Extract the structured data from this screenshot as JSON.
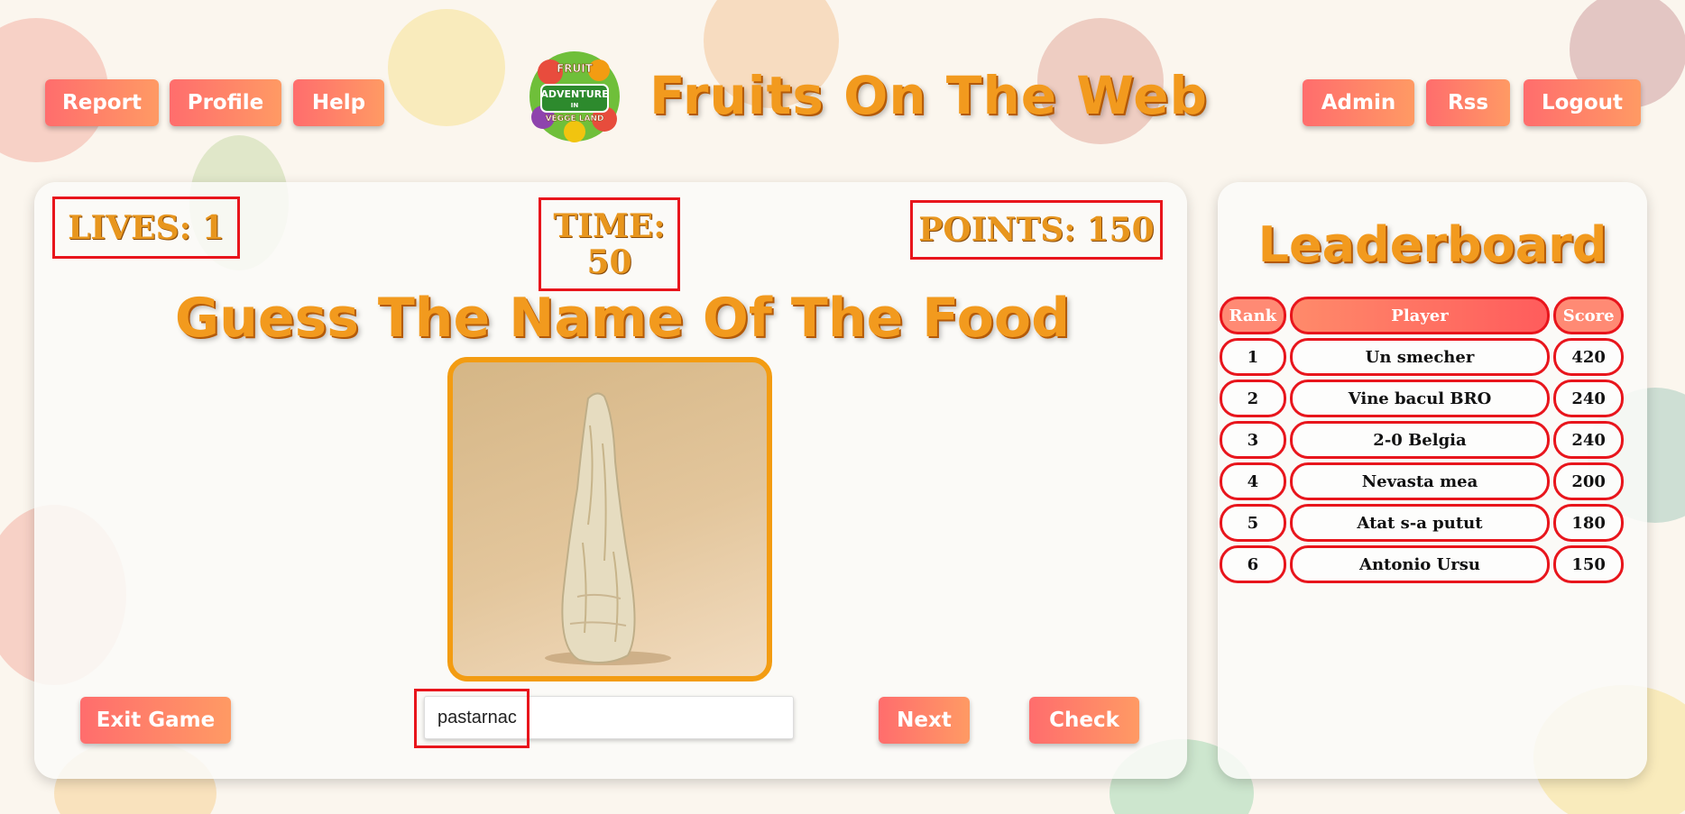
{
  "nav_left": [
    {
      "label": "Report"
    },
    {
      "label": "Profile"
    },
    {
      "label": "Help"
    }
  ],
  "nav_right": [
    {
      "label": "Admin"
    },
    {
      "label": "Rss"
    },
    {
      "label": "Logout"
    }
  ],
  "header": {
    "title": "Fruits On The Web",
    "logo": {
      "line1": "FRUIT",
      "line2": "ADVENTURE",
      "line3": "IN",
      "line4": "VEGGE LAND"
    }
  },
  "game": {
    "lives_label": "LIVES:",
    "lives_value": "1",
    "time_label": "TIME:",
    "time_value": "50",
    "points_label": "POINTS:",
    "points_value": "150",
    "heading": "Guess The Name Of The Food",
    "answer_value": "pastarnac",
    "exit_label": "Exit Game",
    "next_label": "Next",
    "check_label": "Check"
  },
  "leaderboard": {
    "title": "Leaderboard",
    "headers": {
      "rank": "Rank",
      "player": "Player",
      "score": "Score"
    },
    "rows": [
      {
        "rank": "1",
        "player": "Un smecher",
        "score": "420"
      },
      {
        "rank": "2",
        "player": "Vine bacul BRO",
        "score": "240"
      },
      {
        "rank": "3",
        "player": "2-0 Belgia",
        "score": "240"
      },
      {
        "rank": "4",
        "player": "Nevasta mea",
        "score": "200"
      },
      {
        "rank": "5",
        "player": "Atat s-a putut",
        "score": "180"
      },
      {
        "rank": "6",
        "player": "Antonio Ursu",
        "score": "150"
      }
    ]
  },
  "colors": {
    "accent": "#f29a1e",
    "button_start": "#ff6d6d",
    "button_end": "#ff9a64",
    "highlight": "#e8151c"
  }
}
